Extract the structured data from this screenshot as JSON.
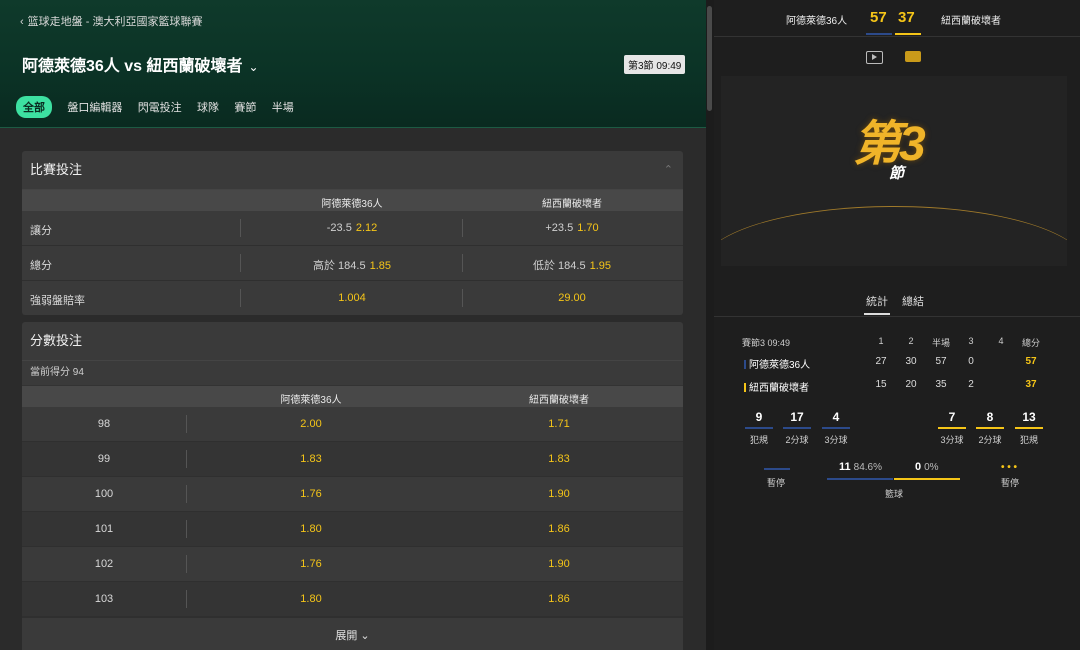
{
  "breadcrumb": "篮球走地盤 - 澳大利亞國家籃球聯賽",
  "match": {
    "title": "阿德萊德36人 vs 紐西蘭破壞者",
    "period_badge": "第3節 09:49"
  },
  "tabs": [
    "全部",
    "盤口編輯器",
    "閃電投注",
    "球隊",
    "賽節",
    "半場"
  ],
  "match_bets": {
    "title": "比賽投注",
    "home_col": "阿德萊德36人",
    "away_col": "紐西蘭破壞者",
    "rows": [
      {
        "label": "讓分",
        "home_line": "-23.5",
        "home_odds": "2.12",
        "away_line": "+23.5",
        "away_odds": "1.70"
      },
      {
        "label": "總分",
        "home_line": "高於 184.5",
        "home_odds": "1.85",
        "away_line": "低於 184.5",
        "away_odds": "1.95"
      },
      {
        "label": "強弱盤賠率",
        "home_line": "",
        "home_odds": "1.004",
        "away_line": "",
        "away_odds": "29.00"
      }
    ]
  },
  "points_bets": {
    "title": "分數投注",
    "current": "當前得分 94",
    "home_col": "阿德萊德36人",
    "away_col": "紐西蘭破壞者",
    "rows": [
      {
        "points": "98",
        "home": "2.00",
        "away": "1.71"
      },
      {
        "points": "99",
        "home": "1.83",
        "away": "1.83"
      },
      {
        "points": "100",
        "home": "1.76",
        "away": "1.90"
      },
      {
        "points": "101",
        "home": "1.80",
        "away": "1.86"
      },
      {
        "points": "102",
        "home": "1.76",
        "away": "1.90"
      },
      {
        "points": "103",
        "home": "1.80",
        "away": "1.86"
      }
    ],
    "expand": "展開"
  },
  "scoreboard": {
    "home": "阿德萊德36人",
    "home_score": "57",
    "away_score": "37",
    "away": "紐西蘭破壞者"
  },
  "visual": {
    "period": "第3",
    "sub": "節"
  },
  "stat_tabs": [
    "統計",
    "總結"
  ],
  "stats": {
    "headers": [
      "賽節3 09:49",
      "1",
      "2",
      "半場",
      "3",
      "4",
      "總分"
    ],
    "home": {
      "name": "阿德萊德36人",
      "q": [
        "27",
        "30",
        "57",
        "0",
        ""
      ],
      "total": "57"
    },
    "away": {
      "name": "紐西蘭破壞者",
      "q": [
        "15",
        "20",
        "35",
        "2",
        ""
      ],
      "total": "37"
    }
  },
  "mini_home": [
    {
      "num": "9",
      "label": "犯規"
    },
    {
      "num": "17",
      "label": "2分球"
    },
    {
      "num": "4",
      "label": "3分球"
    }
  ],
  "mini_away": [
    {
      "num": "7",
      "label": "3分球"
    },
    {
      "num": "8",
      "label": "2分球"
    },
    {
      "num": "13",
      "label": "犯規"
    }
  ],
  "timeout": {
    "home_label": "暫停",
    "away_label": "暫停",
    "away_dots": "• • •"
  },
  "rebounds": {
    "home": "11",
    "home_pct": "84.6%",
    "away": "0",
    "away_pct": "0%",
    "label": "籃球"
  },
  "colors": {
    "accent": "#3de0a1",
    "odds": "#f5c518",
    "home": "#2c4a8a",
    "away": "#f5c518"
  }
}
